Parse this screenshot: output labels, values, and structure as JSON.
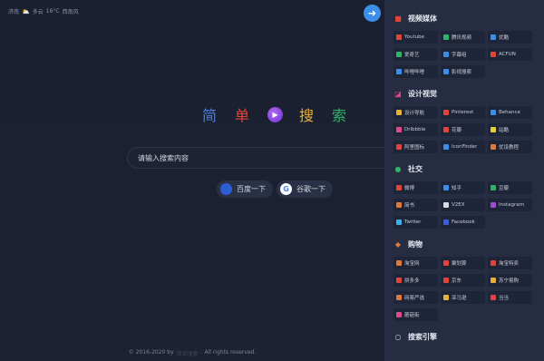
{
  "weather": {
    "city": "济南",
    "condition": "多云",
    "temp": "16°C",
    "wind": "西南风"
  },
  "logo": {
    "chars": [
      "简",
      "单",
      "搜",
      "索"
    ]
  },
  "search": {
    "placeholder": "请输入搜索内容"
  },
  "engines": {
    "baidu": "百度一下",
    "google": "谷歌一下"
  },
  "footer": {
    "copy": "© 2016-2020 by",
    "brand": "简单搜索",
    "rights": ". All rights reserved."
  },
  "colors": {
    "accent": "#3b8fe8",
    "sidebar": "#262d42",
    "background": "#1b2130"
  },
  "sections": [
    {
      "title": "视频媒体",
      "icon_color": "#e0453a",
      "items": [
        {
          "label": "Youtube",
          "color": "#e0453a"
        },
        {
          "label": "腾讯视频",
          "color": "#2fb36a"
        },
        {
          "label": "优酷",
          "color": "#3b8fe8"
        },
        {
          "label": "爱奇艺",
          "color": "#2fb36a"
        },
        {
          "label": "字幕组",
          "color": "#3b8fe8"
        },
        {
          "label": "ACFUN",
          "color": "#e0453a"
        },
        {
          "label": "哔哩哔哩",
          "color": "#3b8fe8"
        },
        {
          "label": "影视搜索",
          "color": "#3b8fe8"
        }
      ]
    },
    {
      "title": "设计视觉",
      "icon_color": "#e04a8a",
      "items": [
        {
          "label": "设计导航",
          "color": "#e6b03a"
        },
        {
          "label": "Pinterest",
          "color": "#e0453a"
        },
        {
          "label": "Behance",
          "color": "#3b8fe8"
        },
        {
          "label": "Dribbble",
          "color": "#e04a8a"
        },
        {
          "label": "花瓣",
          "color": "#e0453a"
        },
        {
          "label": "站酷",
          "color": "#e6d03a"
        },
        {
          "label": "阿里图标",
          "color": "#e0453a"
        },
        {
          "label": "IconFinder",
          "color": "#3b8fe8"
        },
        {
          "label": "优设教程",
          "color": "#e07a3a"
        }
      ]
    },
    {
      "title": "社交",
      "icon_color": "#2fb36a",
      "items": [
        {
          "label": "微博",
          "color": "#e0453a"
        },
        {
          "label": "知乎",
          "color": "#3b8fe8"
        },
        {
          "label": "豆瓣",
          "color": "#2fb36a"
        },
        {
          "label": "简书",
          "color": "#e07a3a"
        },
        {
          "label": "V2EX",
          "color": "#d6dae2"
        },
        {
          "label": "Instagram",
          "color": "#a04ad6"
        },
        {
          "label": "Twitter",
          "color": "#3bb0e8"
        },
        {
          "label": "Facebook",
          "color": "#3b5fd6"
        }
      ]
    },
    {
      "title": "购物",
      "icon_color": "#e07a3a",
      "items": [
        {
          "label": "淘宝网",
          "color": "#e07a3a"
        },
        {
          "label": "聚划算",
          "color": "#e0453a"
        },
        {
          "label": "淘宝特卖",
          "color": "#e0453a"
        },
        {
          "label": "拼多多",
          "color": "#e0453a"
        },
        {
          "label": "京东",
          "color": "#e0453a"
        },
        {
          "label": "苏宁易购",
          "color": "#e6b03a"
        },
        {
          "label": "网易严选",
          "color": "#e07a3a"
        },
        {
          "label": "亚马逊",
          "color": "#e6b03a"
        },
        {
          "label": "当当",
          "color": "#e0453a"
        },
        {
          "label": "蘑菇街",
          "color": "#e04a8a"
        }
      ]
    },
    {
      "title": "搜索引擎",
      "icon_color": "#d6dae2",
      "items": []
    }
  ]
}
